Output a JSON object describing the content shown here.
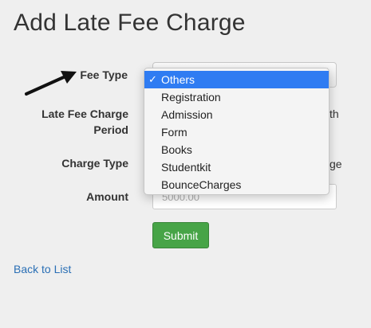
{
  "page": {
    "title": "Add Late Fee Charge"
  },
  "form": {
    "fee_type_label": "Fee Type",
    "late_fee_period_label_line1": "Late Fee Charge",
    "late_fee_period_label_line2": "Period",
    "late_fee_period_peek": "th",
    "charge_type_label": "Charge Type",
    "charge_type_peek": "ge",
    "amount_label": "Amount",
    "amount_placeholder": "5000.00",
    "submit_label": "Submit"
  },
  "fee_type_dropdown": {
    "check_mark": "✓",
    "options": [
      {
        "label": "Others",
        "selected": true
      },
      {
        "label": "Registration",
        "selected": false
      },
      {
        "label": "Admission",
        "selected": false
      },
      {
        "label": "Form",
        "selected": false
      },
      {
        "label": "Books",
        "selected": false
      },
      {
        "label": "Studentkit",
        "selected": false
      },
      {
        "label": "BounceCharges",
        "selected": false
      }
    ]
  },
  "links": {
    "back_label": "Back to List"
  },
  "colors": {
    "submit_bg": "#47a447",
    "link": "#2a6fb5",
    "selected_option_bg": "#2f7cf2",
    "annotation_arrow": "#111111"
  }
}
